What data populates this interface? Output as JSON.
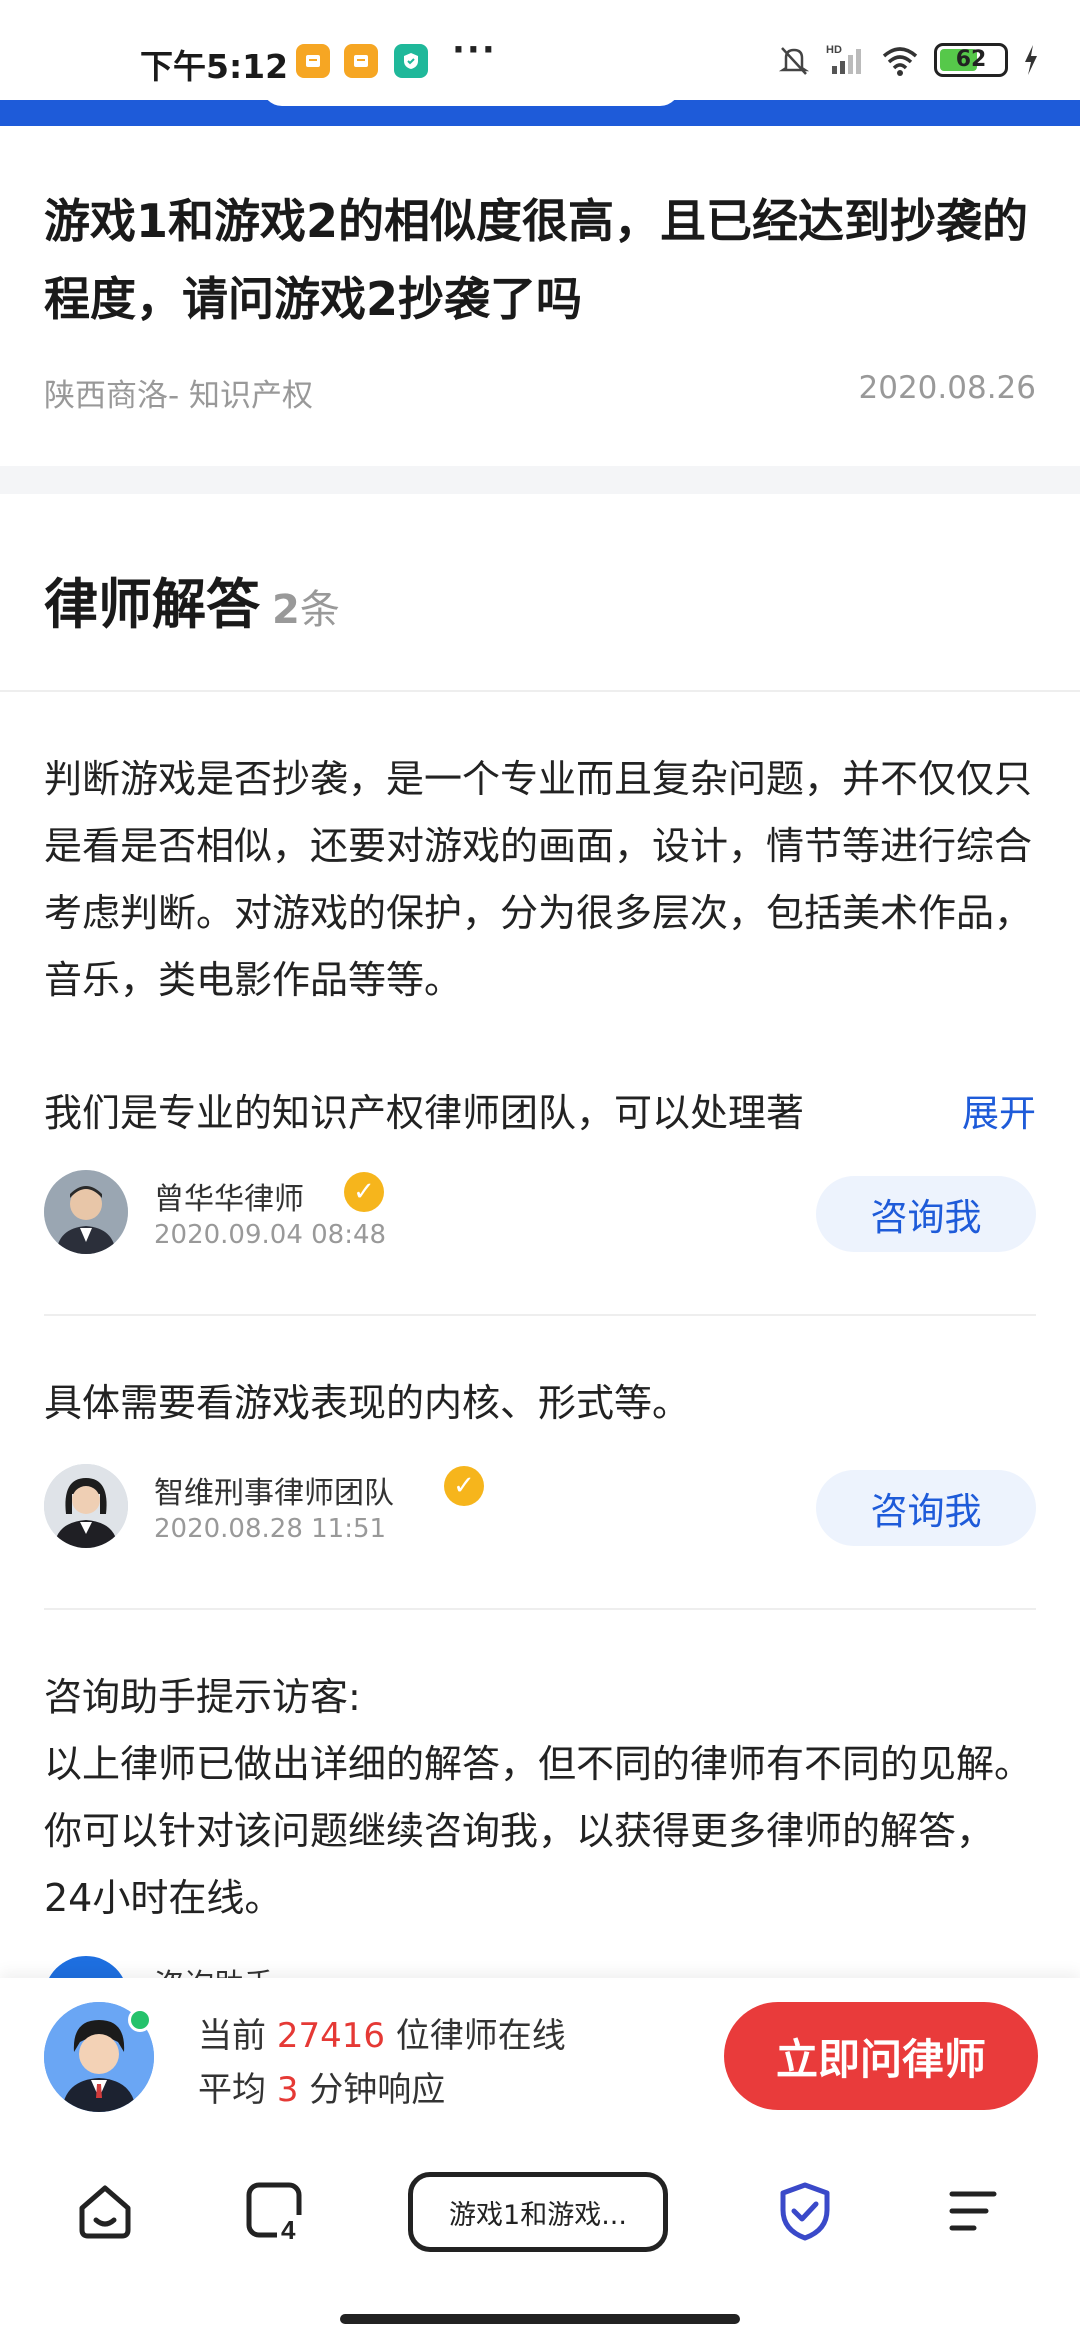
{
  "status_bar": {
    "time": "下午5:12",
    "more": "···",
    "battery": "62"
  },
  "question": {
    "title": "游戏1和游戏2的相似度很高，且已经达到抄袭的程度，请问游戏2抄袭了吗",
    "location": "陕西商洛- 知识产权",
    "date": "2020.08.26"
  },
  "answers_section": {
    "title": "律师解答",
    "count": "2",
    "count_unit": "条"
  },
  "answers": [
    {
      "text": "判断游戏是否抄袭，是一个专业而且复杂问题，并不仅仅只是看是否相似，还要对游戏的画面，设计，情节等进行综合考虑判断。对游戏的保护，分为很多层次，包括美术作品，音乐，类电影作品等等。",
      "text_last_line": "我们是专业的知识产权律师团队，可以处理著",
      "expand_label": "展开",
      "lawyer_name": "曾华华律师",
      "time": "2020.09.04 08:48",
      "consult_label": "咨询我"
    },
    {
      "text": "具体需要看游戏表现的内核、形式等。",
      "lawyer_name": "智维刑事律师团队",
      "time": "2020.08.28 11:51",
      "consult_label": "咨询我"
    }
  ],
  "assistant_note": {
    "heading": "咨询助手提示访客:",
    "text": "以上律师已做出详细的解答，但不同的律师有不同的见解。 你可以针对该问题继续咨询我，以获得更多律师的解答，24小时在线。",
    "partial_name": "咨询助手"
  },
  "promo": {
    "line1_prefix": "当前 ",
    "online_count": "27416",
    "line1_suffix": " 位律师在线",
    "line2_prefix": "平均 ",
    "response_minutes": "3",
    "line2_suffix": " 分钟响应",
    "button_label": "立即问律师"
  },
  "browser_nav": {
    "tab_title": "游戏1和游戏...",
    "tab_count": "4"
  },
  "colors": {
    "accent_blue": "#1e5bd9",
    "accent_red": "#e93b3b",
    "badge_gold": "#f6b51c"
  }
}
